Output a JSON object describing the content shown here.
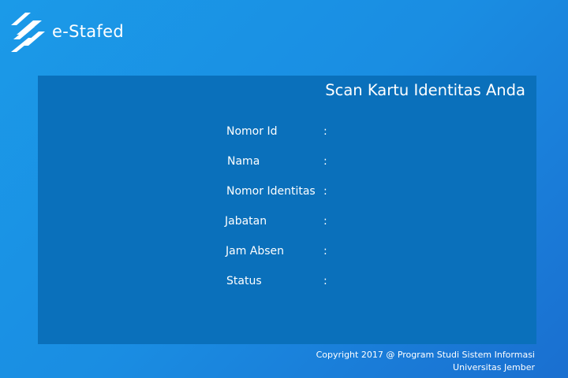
{
  "app": {
    "brand_name": "e-Stafed",
    "logo_icon": "stacked-slash-stripes-icon"
  },
  "panel": {
    "title": "Scan Kartu Identitas Anda",
    "fields": [
      {
        "label": "Nomor Id",
        "colon": ":",
        "value": ""
      },
      {
        "label": "Nama",
        "colon": ":",
        "value": ""
      },
      {
        "label": "Nomor Identitas",
        "colon": ":",
        "value": ""
      },
      {
        "label": "Jabatan",
        "colon": ":",
        "value": ""
      },
      {
        "label": "Jam Absen",
        "colon": ":",
        "value": ""
      },
      {
        "label": "Status",
        "colon": ":",
        "value": ""
      }
    ]
  },
  "footer": {
    "line1": "Copyright 2017 @ Program Studi Sistem Informasi",
    "line2": "Universitas Jember"
  },
  "colors": {
    "background_start": "#1b9ae8",
    "background_end": "#1a6fd0",
    "panel": "#0a70bb",
    "text": "#ffffff"
  }
}
